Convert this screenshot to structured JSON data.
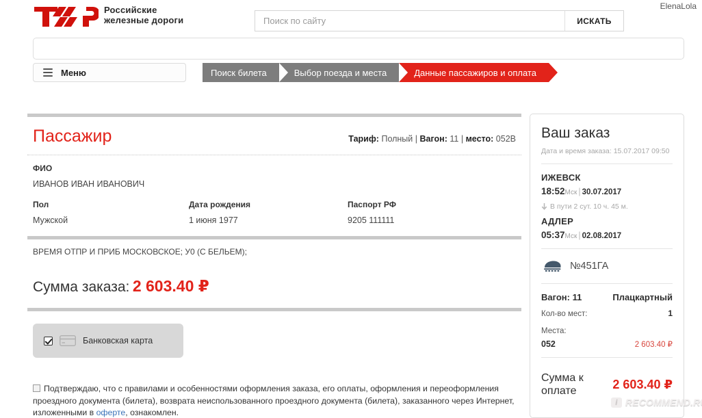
{
  "header": {
    "logo_alt": "rzd-logo",
    "brand_line1": "Российские",
    "brand_line2": "железные дороги",
    "username": "ElenaLola",
    "search": {
      "value": "",
      "placeholder": "Поиск по сайту",
      "button_label": "ИСКАТЬ"
    }
  },
  "nav": {
    "menu_label": "Меню",
    "steps": [
      {
        "label": "Поиск билета",
        "state": "done"
      },
      {
        "label": "Выбор поезда и места",
        "state": "done"
      },
      {
        "label": "Данные пассажиров и оплата",
        "state": "active"
      }
    ]
  },
  "passenger": {
    "title": "Пассажир",
    "fare": {
      "tariff_label": "Тариф:",
      "tariff_value": "Полный",
      "wagon_label": "Вагон:",
      "wagon_value": "11",
      "seat_label": "место:",
      "seat_value": "052В",
      "separator": "|"
    },
    "fio_label": "ФИО",
    "fio_value": "ИВАНОВ ИВАН ИВАНОВИЧ",
    "gender_label": "Пол",
    "gender_value": "Мужской",
    "birth_label": "Дата рождения",
    "birth_value": "1 июня 1977",
    "passport_label": "Паспорт РФ",
    "passport_value": "9205 111111",
    "note": "ВРЕМЯ ОТПР И ПРИБ МОСКОВСКОЕ; У0 (С БЕЛЬЕМ);"
  },
  "order_sum": {
    "label": "Сумма заказа:",
    "value": "2 603.40 ₽"
  },
  "payment": {
    "method_label": "Банковская карта",
    "selected": true
  },
  "consent": {
    "text_before_link": "Подтверждаю, что с правилами и особенностями оформления заказа, его оплаты, оформления и переоформления проездного документа (билета), возврата неиспользованного проездного документа (билета), заказанного через Интернет, изложенными в ",
    "link_text": "оферте",
    "text_after_link": ", ознакомлен."
  },
  "order_panel": {
    "title": "Ваш заказ",
    "order_datetime": "Дата и время заказа: 15.07.2017 09:50",
    "from_station": "ИЖЕВСК",
    "from_time": "18:52",
    "from_tz": "Мск",
    "from_date": "30.07.2017",
    "duration": "В пути 2 сут. 10 ч. 45 м.",
    "to_station": "АДЛЕР",
    "to_time": "05:37",
    "to_tz": "Мск",
    "to_date": "02.08.2017",
    "train_number": "№451ГА",
    "wagon_label": "Вагон: 11",
    "wagon_type": "Плацкартный",
    "seats_count_label": "Кол-во мест:",
    "seats_count_value": "1",
    "seats_label": "Места:",
    "seat_number": "052",
    "seat_price": "2 603.40 ₽",
    "total_label": "Сумма к оплате",
    "total_value": "2 603.40 ₽"
  },
  "watermark": {
    "text": "RECOMMEND.RU",
    "badge": "i"
  },
  "colors": {
    "brand_red": "#e2231a",
    "step_grey": "#7d7d7d",
    "link_blue": "#3b73b9",
    "divider_grey": "#c9c9c9"
  }
}
